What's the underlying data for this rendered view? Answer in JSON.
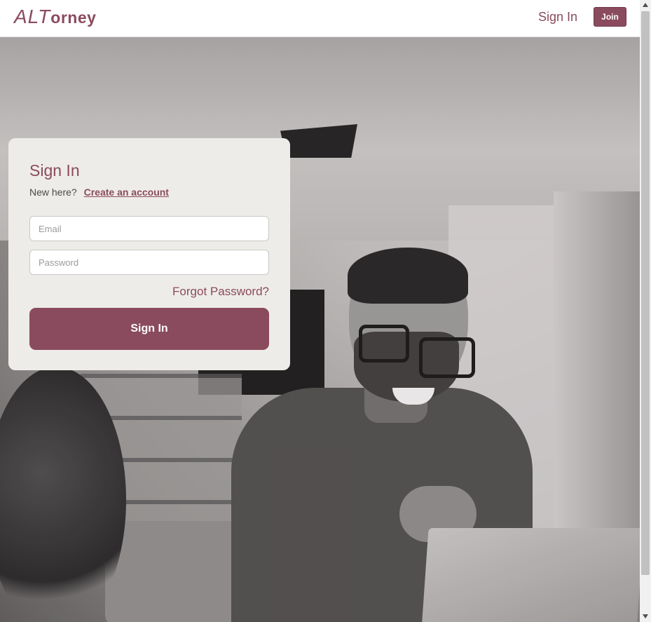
{
  "header": {
    "logo_alt": "ALT",
    "logo_rest": "orney",
    "nav_signin": "Sign In",
    "join_label": "Join"
  },
  "signin": {
    "title": "Sign In",
    "new_here": "New here?",
    "create_account": "Create an account",
    "email_placeholder": "Email",
    "password_placeholder": "Password",
    "forgot_password": "Forgot Password?",
    "submit_label": "Sign In"
  },
  "colors": {
    "brand": "#8a4b5e",
    "card_bg": "#eeece8",
    "page_bg": "#ffffff"
  },
  "icons": [
    "scroll-up-arrow-icon",
    "scroll-down-arrow-icon"
  ]
}
